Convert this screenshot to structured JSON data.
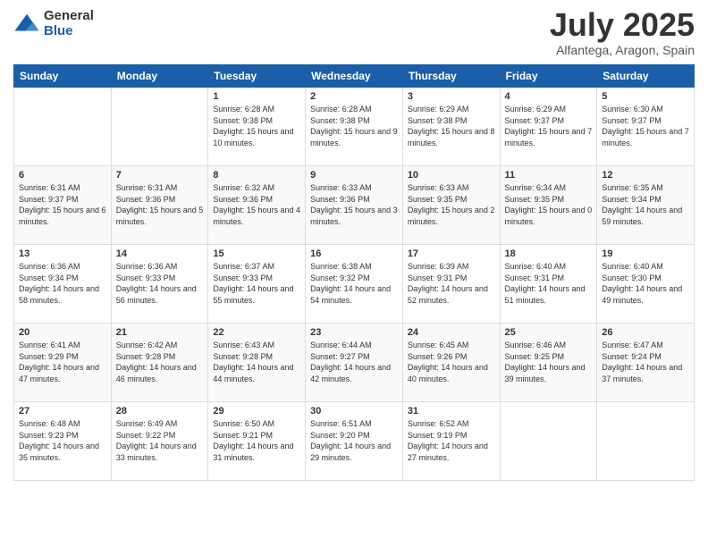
{
  "logo": {
    "general": "General",
    "blue": "Blue"
  },
  "title": "July 2025",
  "subtitle": "Alfantega, Aragon, Spain",
  "days_of_week": [
    "Sunday",
    "Monday",
    "Tuesday",
    "Wednesday",
    "Thursday",
    "Friday",
    "Saturday"
  ],
  "weeks": [
    [
      {
        "day": "",
        "info": ""
      },
      {
        "day": "",
        "info": ""
      },
      {
        "day": "1",
        "info": "Sunrise: 6:28 AM\nSunset: 9:38 PM\nDaylight: 15 hours and 10 minutes."
      },
      {
        "day": "2",
        "info": "Sunrise: 6:28 AM\nSunset: 9:38 PM\nDaylight: 15 hours and 9 minutes."
      },
      {
        "day": "3",
        "info": "Sunrise: 6:29 AM\nSunset: 9:38 PM\nDaylight: 15 hours and 8 minutes."
      },
      {
        "day": "4",
        "info": "Sunrise: 6:29 AM\nSunset: 9:37 PM\nDaylight: 15 hours and 7 minutes."
      },
      {
        "day": "5",
        "info": "Sunrise: 6:30 AM\nSunset: 9:37 PM\nDaylight: 15 hours and 7 minutes."
      }
    ],
    [
      {
        "day": "6",
        "info": "Sunrise: 6:31 AM\nSunset: 9:37 PM\nDaylight: 15 hours and 6 minutes."
      },
      {
        "day": "7",
        "info": "Sunrise: 6:31 AM\nSunset: 9:36 PM\nDaylight: 15 hours and 5 minutes."
      },
      {
        "day": "8",
        "info": "Sunrise: 6:32 AM\nSunset: 9:36 PM\nDaylight: 15 hours and 4 minutes."
      },
      {
        "day": "9",
        "info": "Sunrise: 6:33 AM\nSunset: 9:36 PM\nDaylight: 15 hours and 3 minutes."
      },
      {
        "day": "10",
        "info": "Sunrise: 6:33 AM\nSunset: 9:35 PM\nDaylight: 15 hours and 2 minutes."
      },
      {
        "day": "11",
        "info": "Sunrise: 6:34 AM\nSunset: 9:35 PM\nDaylight: 15 hours and 0 minutes."
      },
      {
        "day": "12",
        "info": "Sunrise: 6:35 AM\nSunset: 9:34 PM\nDaylight: 14 hours and 59 minutes."
      }
    ],
    [
      {
        "day": "13",
        "info": "Sunrise: 6:36 AM\nSunset: 9:34 PM\nDaylight: 14 hours and 58 minutes."
      },
      {
        "day": "14",
        "info": "Sunrise: 6:36 AM\nSunset: 9:33 PM\nDaylight: 14 hours and 56 minutes."
      },
      {
        "day": "15",
        "info": "Sunrise: 6:37 AM\nSunset: 9:33 PM\nDaylight: 14 hours and 55 minutes."
      },
      {
        "day": "16",
        "info": "Sunrise: 6:38 AM\nSunset: 9:32 PM\nDaylight: 14 hours and 54 minutes."
      },
      {
        "day": "17",
        "info": "Sunrise: 6:39 AM\nSunset: 9:31 PM\nDaylight: 14 hours and 52 minutes."
      },
      {
        "day": "18",
        "info": "Sunrise: 6:40 AM\nSunset: 9:31 PM\nDaylight: 14 hours and 51 minutes."
      },
      {
        "day": "19",
        "info": "Sunrise: 6:40 AM\nSunset: 9:30 PM\nDaylight: 14 hours and 49 minutes."
      }
    ],
    [
      {
        "day": "20",
        "info": "Sunrise: 6:41 AM\nSunset: 9:29 PM\nDaylight: 14 hours and 47 minutes."
      },
      {
        "day": "21",
        "info": "Sunrise: 6:42 AM\nSunset: 9:28 PM\nDaylight: 14 hours and 46 minutes."
      },
      {
        "day": "22",
        "info": "Sunrise: 6:43 AM\nSunset: 9:28 PM\nDaylight: 14 hours and 44 minutes."
      },
      {
        "day": "23",
        "info": "Sunrise: 6:44 AM\nSunset: 9:27 PM\nDaylight: 14 hours and 42 minutes."
      },
      {
        "day": "24",
        "info": "Sunrise: 6:45 AM\nSunset: 9:26 PM\nDaylight: 14 hours and 40 minutes."
      },
      {
        "day": "25",
        "info": "Sunrise: 6:46 AM\nSunset: 9:25 PM\nDaylight: 14 hours and 39 minutes."
      },
      {
        "day": "26",
        "info": "Sunrise: 6:47 AM\nSunset: 9:24 PM\nDaylight: 14 hours and 37 minutes."
      }
    ],
    [
      {
        "day": "27",
        "info": "Sunrise: 6:48 AM\nSunset: 9:23 PM\nDaylight: 14 hours and 35 minutes."
      },
      {
        "day": "28",
        "info": "Sunrise: 6:49 AM\nSunset: 9:22 PM\nDaylight: 14 hours and 33 minutes."
      },
      {
        "day": "29",
        "info": "Sunrise: 6:50 AM\nSunset: 9:21 PM\nDaylight: 14 hours and 31 minutes."
      },
      {
        "day": "30",
        "info": "Sunrise: 6:51 AM\nSunset: 9:20 PM\nDaylight: 14 hours and 29 minutes."
      },
      {
        "day": "31",
        "info": "Sunrise: 6:52 AM\nSunset: 9:19 PM\nDaylight: 14 hours and 27 minutes."
      },
      {
        "day": "",
        "info": ""
      },
      {
        "day": "",
        "info": ""
      }
    ]
  ]
}
